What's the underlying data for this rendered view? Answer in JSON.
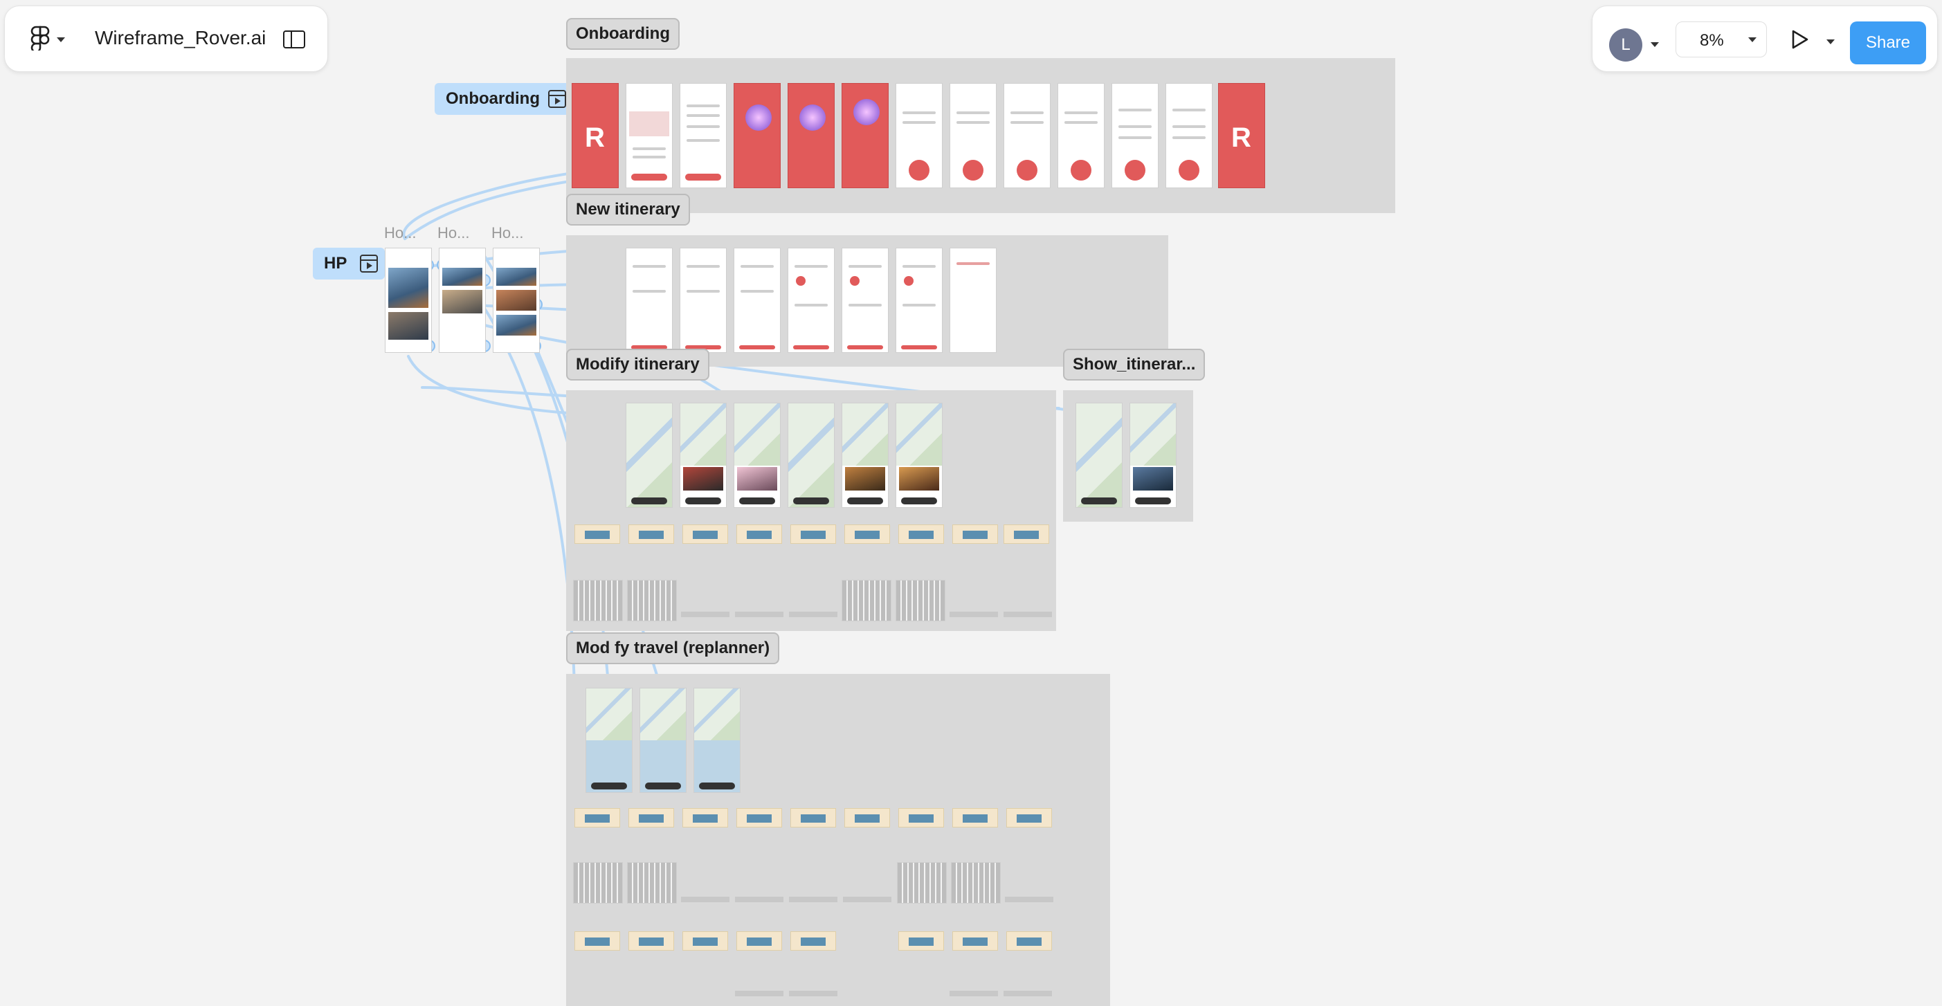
{
  "toolbar": {
    "file_name": "Wireframe_Rover.ai",
    "menu_icon": "figma-logo-icon",
    "sidebar_icon": "sidebar-toggle-icon",
    "avatar_initial": "L",
    "zoom": "8%",
    "share_label": "Share"
  },
  "colors": {
    "accent": "#3d9ef5",
    "connector": "#b7d7f5",
    "brand_red": "#e15a5a",
    "section_bg": "#d9d9d9"
  },
  "sections": {
    "onboarding": "Onboarding",
    "new_itinerary": "New itinerary",
    "modify_itinerary": "Modify itinerary",
    "show_itinerary": "Show_itinerar...",
    "modify_travel": "Mod fy travel (replanner)"
  },
  "flows": {
    "onboarding": "Onboarding",
    "hp": "HP"
  },
  "hp_frame_titles": [
    "Ho...",
    "Ho...",
    "Ho..."
  ]
}
